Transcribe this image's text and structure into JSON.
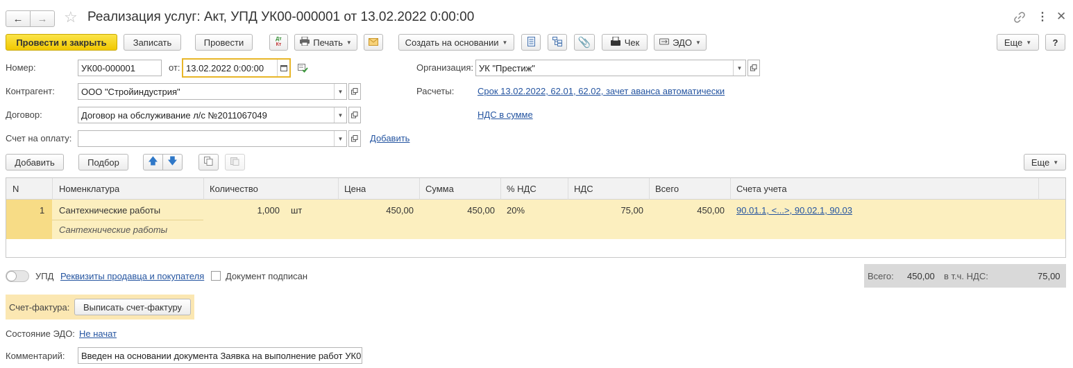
{
  "window": {
    "title": "Реализация услуг: Акт, УПД УК00-000001 от 13.02.2022 0:00:00"
  },
  "toolbar": {
    "post_close": "Провести и закрыть",
    "save": "Записать",
    "post": "Провести",
    "dtkt_top": "Дт",
    "dtkt_bottom": "Кт",
    "print": "Печать",
    "create_based": "Создать на основании",
    "check": "Чек",
    "edo": "ЭДО",
    "more": "Еще",
    "help": "?"
  },
  "form": {
    "number_label": "Номер:",
    "number_value": "УК00-000001",
    "date_label": "от:",
    "date_value": "13.02.2022  0:00:00",
    "org_label": "Организация:",
    "org_value": "УК \"Престиж\"",
    "contractor_label": "Контрагент:",
    "contractor_value": "ООО \"Стройиндустрия\"",
    "settlements_label": "Расчеты:",
    "settlements_link": "Срок 13.02.2022, 62.01, 62.02, зачет аванса автоматически",
    "contract_label": "Договор:",
    "contract_value": "Договор на обслуживание л/с №2011067049",
    "vat_link": "НДС в сумме",
    "invoice_label": "Счет на оплату:",
    "invoice_value": "",
    "add_link": "Добавить"
  },
  "table_toolbar": {
    "add": "Добавить",
    "pick": "Подбор",
    "more": "Еще"
  },
  "table": {
    "headers": [
      "N",
      "Номенклатура",
      "Количество",
      "Цена",
      "Сумма",
      "% НДС",
      "НДС",
      "Всего",
      "Счета учета"
    ],
    "rows": [
      {
        "n": "1",
        "item": "Сантехнические работы",
        "item_sub": "Сантехнические работы",
        "qty": "1,000",
        "unit": "шт",
        "price": "450,00",
        "sum": "450,00",
        "vat_rate": "20%",
        "vat": "75,00",
        "total": "450,00",
        "accounts": "90.01.1, <...>, 90.02.1, 90.03"
      }
    ]
  },
  "footer": {
    "upd_label": "УПД",
    "requisites_link": "Реквизиты продавца и покупателя",
    "signed_label": "Документ подписан",
    "total_label": "Всего:",
    "total_value": "450,00",
    "vat_incl_label": "в т.ч. НДС:",
    "vat_incl_value": "75,00",
    "invoice_label": "Счет-фактура:",
    "invoice_button": "Выписать счет-фактуру",
    "edo_state_label": "Состояние ЭДО:",
    "edo_state_link": "Не начат",
    "comment_label": "Комментарий:",
    "comment_value": "Введен на основании документа Заявка на выполнение работ УК0"
  },
  "colors": {
    "accent_yellow": "#f4d000",
    "row_highlight": "#fcefbf",
    "link_blue": "#2454a0",
    "focus_border": "#e8b628"
  }
}
